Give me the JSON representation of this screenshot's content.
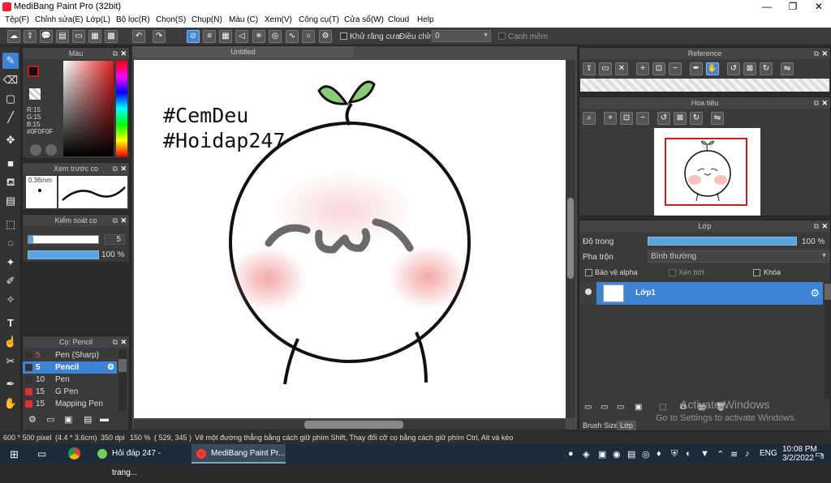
{
  "window": {
    "title": "MediBang Paint Pro (32bit)",
    "minimize": "—",
    "maximize": "❐",
    "close": "✕"
  },
  "menu": [
    "Tệp(F)",
    "Chỉnh sửa(E)",
    "Lớp(L)",
    "Bộ lọc(R)",
    "Chọn(S)",
    "Chụp(N)",
    "Màu (C)",
    "Xem(V)",
    "Công cụ(T)",
    "Cửa sổ(W)",
    "Cloud",
    "Help"
  ],
  "toolbar": {
    "antialias_label": "Khử răng cưa",
    "adjust_label": "Điều chỉnh",
    "adjust_value": "0",
    "edge_label": "Cạnh mềm"
  },
  "color_panel": {
    "title": "Màu",
    "r": "R:15",
    "g": "G:15",
    "b": "B:15",
    "hex": "#0F0F0F",
    "fg_color": "#0F0F0F",
    "accent": "#cc1a1a"
  },
  "preview_panel": {
    "title": "Xem trước cọ",
    "size": "0.36mm"
  },
  "brush_control": {
    "title": "Kiểm soát cọ",
    "size_value": "5",
    "opacity_value": "100 %"
  },
  "brush_list": {
    "title": "Cọ: Pencil",
    "items": [
      {
        "size": "5",
        "name": "Pen (Sharp)",
        "color": "#333333"
      },
      {
        "size": "5",
        "name": "Pencil",
        "color": "#333333"
      },
      {
        "size": "10",
        "name": "Pen",
        "color": "#333333"
      },
      {
        "size": "15",
        "name": "G Pen",
        "color": "#e03030"
      },
      {
        "size": "15",
        "name": "Mapping Pen",
        "color": "#e03030"
      }
    ]
  },
  "canvas": {
    "tab_title": "Untitled",
    "line1": "#CemDeu",
    "line2": "#Hoidap247"
  },
  "reference_panel": {
    "title": "Reference"
  },
  "navigator_panel": {
    "title": "Hoa tiêu"
  },
  "layer_panel": {
    "title": "Lớp",
    "opacity_label": "Độ trong",
    "opacity_value": "100 %",
    "blend_label": "Pha trộn",
    "blend_value": "Bình thường",
    "protect_alpha": "Bảo vệ alpha",
    "clipping": "Xén bớt",
    "lock": "Khóa",
    "layer_name": "Lớp1",
    "brush_size_tab": "Brush Size",
    "layer_tab": "Lớp"
  },
  "watermark": {
    "line1": "Activate Windows",
    "line2": "Go to Settings to activate Windows."
  },
  "status": {
    "size": "600 * 500 pixel",
    "dim": "(4.4 * 3.6cm)",
    "dpi": "350 dpi",
    "zoom": "150 %",
    "coord": "( 529, 345 )",
    "hint": "Vẽ một đường thẳng bằng cách giữ phím Shift, Thay đổi cỡ cọ bằng cách giữ phím Ctrl, Alt và kéo"
  },
  "taskbar": {
    "task1": "Hỏi đáp 247 - trang...",
    "task2": "MediBang Paint Pr...",
    "lang": "ENG",
    "time": "10:08 PM",
    "date": "3/2/2022",
    "notif": "3"
  }
}
